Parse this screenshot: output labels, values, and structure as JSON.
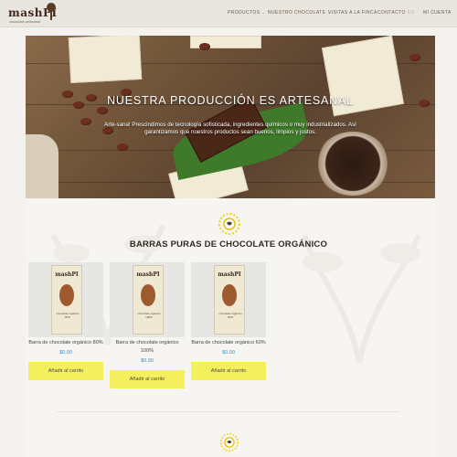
{
  "header": {
    "logo_text": "mashPI",
    "logo_sub": "chocolate artesanal",
    "nav": [
      {
        "label": "PRODUCTOS",
        "has_dropdown": true
      },
      {
        "label": "NUESTRO CHOCOLATE",
        "has_dropdown": true
      },
      {
        "label": "VISITAS A LA FINCA",
        "has_dropdown": false
      },
      {
        "label": "CONTACTO",
        "has_dropdown": false
      },
      {
        "label": "ES",
        "has_dropdown": false
      },
      {
        "label": "MI CUENTA",
        "has_dropdown": false
      }
    ]
  },
  "hero": {
    "title": "NUESTRA PRODUCCIÓN ES ARTESANAL",
    "text": "Arte-sana! Prescindimos de tecnología sofisticada, ingredientes químicos o muy industrializados. Así garantizamos que nuestros productos sean buenos, limpios y justos."
  },
  "section": {
    "title": "BARRAS PURAS DE CHOCOLATE ORGÁNICO"
  },
  "products": [
    {
      "name": "Barra de chocolate orgánico 80%",
      "price": "$0.00",
      "button": "Añadir al carrito",
      "pkg_brand": "mashPI",
      "pkg_label": "chocolate orgánico 80%"
    },
    {
      "name": "Barra de chocolate orgánico 100%",
      "price": "$0.00",
      "button": "Añadir al carrito",
      "pkg_brand": "mashPI",
      "pkg_label": "chocolate orgánico 100%"
    },
    {
      "name": "Barra de chocolate orgánico 60%",
      "price": "$0.00",
      "button": "Añadir al carrito",
      "pkg_brand": "mashPI",
      "pkg_label": "chocolate orgánico 60%"
    }
  ],
  "colors": {
    "accent_button": "#f4ef5c",
    "price": "#3a8cc4",
    "header_bg": "#e9e5df"
  },
  "icons": [
    "cacao-tree-logo",
    "sun-flower-icon",
    "chevron-down-icon"
  ]
}
